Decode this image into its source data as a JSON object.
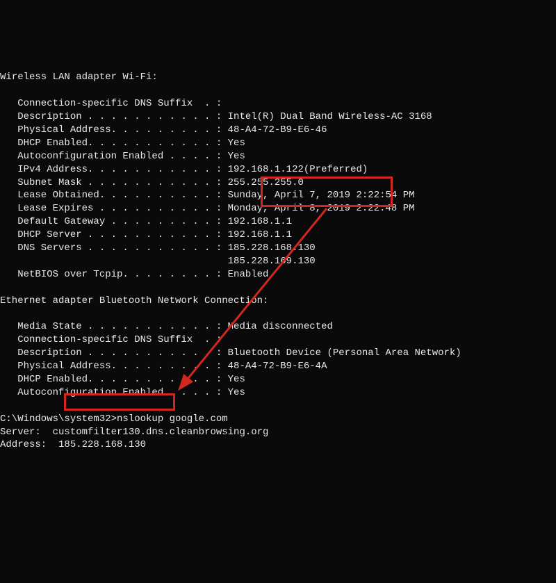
{
  "wifi": {
    "header": "Wireless LAN adapter Wi-Fi:",
    "dns_suffix": "   Connection-specific DNS Suffix  . :",
    "description": "   Description . . . . . . . . . . . : Intel(R) Dual Band Wireless-AC 3168",
    "physaddr": "   Physical Address. . . . . . . . . : 48-A4-72-B9-E6-46",
    "dhcp": "   DHCP Enabled. . . . . . . . . . . : Yes",
    "autoconf": "   Autoconfiguration Enabled . . . . : Yes",
    "ipv4": "   IPv4 Address. . . . . . . . . . . : 192.168.1.122(Preferred)",
    "subnet": "   Subnet Mask . . . . . . . . . . . : 255.255.255.0",
    "lease_obt": "   Lease Obtained. . . . . . . . . . : Sunday, April 7, 2019 2:22:54 PM",
    "lease_exp": "   Lease Expires . . . . . . . . . . : Monday, April 8, 2019 2:22:48 PM",
    "gateway": "   Default Gateway . . . . . . . . . : 192.168.1.1",
    "dhcp_server": "   DHCP Server . . . . . . . . . . . : 192.168.1.1",
    "dns1": "   DNS Servers . . . . . . . . . . . : 185.228.168.130",
    "dns2": "                                       185.228.169.130",
    "netbios": "   NetBIOS over Tcpip. . . . . . . . : Enabled"
  },
  "bt": {
    "header": "Ethernet adapter Bluetooth Network Connection:",
    "media": "   Media State . . . . . . . . . . . : Media disconnected",
    "dns_suffix": "   Connection-specific DNS Suffix  . :",
    "description": "   Description . . . . . . . . . . . : Bluetooth Device (Personal Area Network)",
    "physaddr": "   Physical Address. . . . . . . . . : 48-A4-72-B9-E6-4A",
    "dhcp": "   DHCP Enabled. . . . . . . . . . . : Yes",
    "autoconf": "   Autoconfiguration Enabled . . . . : Yes"
  },
  "prompt": "C:\\Windows\\system32>nslookup google.com",
  "server": "Server:  customfilter130.dns.cleanbrowsing.org",
  "address": "Address:  185.228.168.130"
}
